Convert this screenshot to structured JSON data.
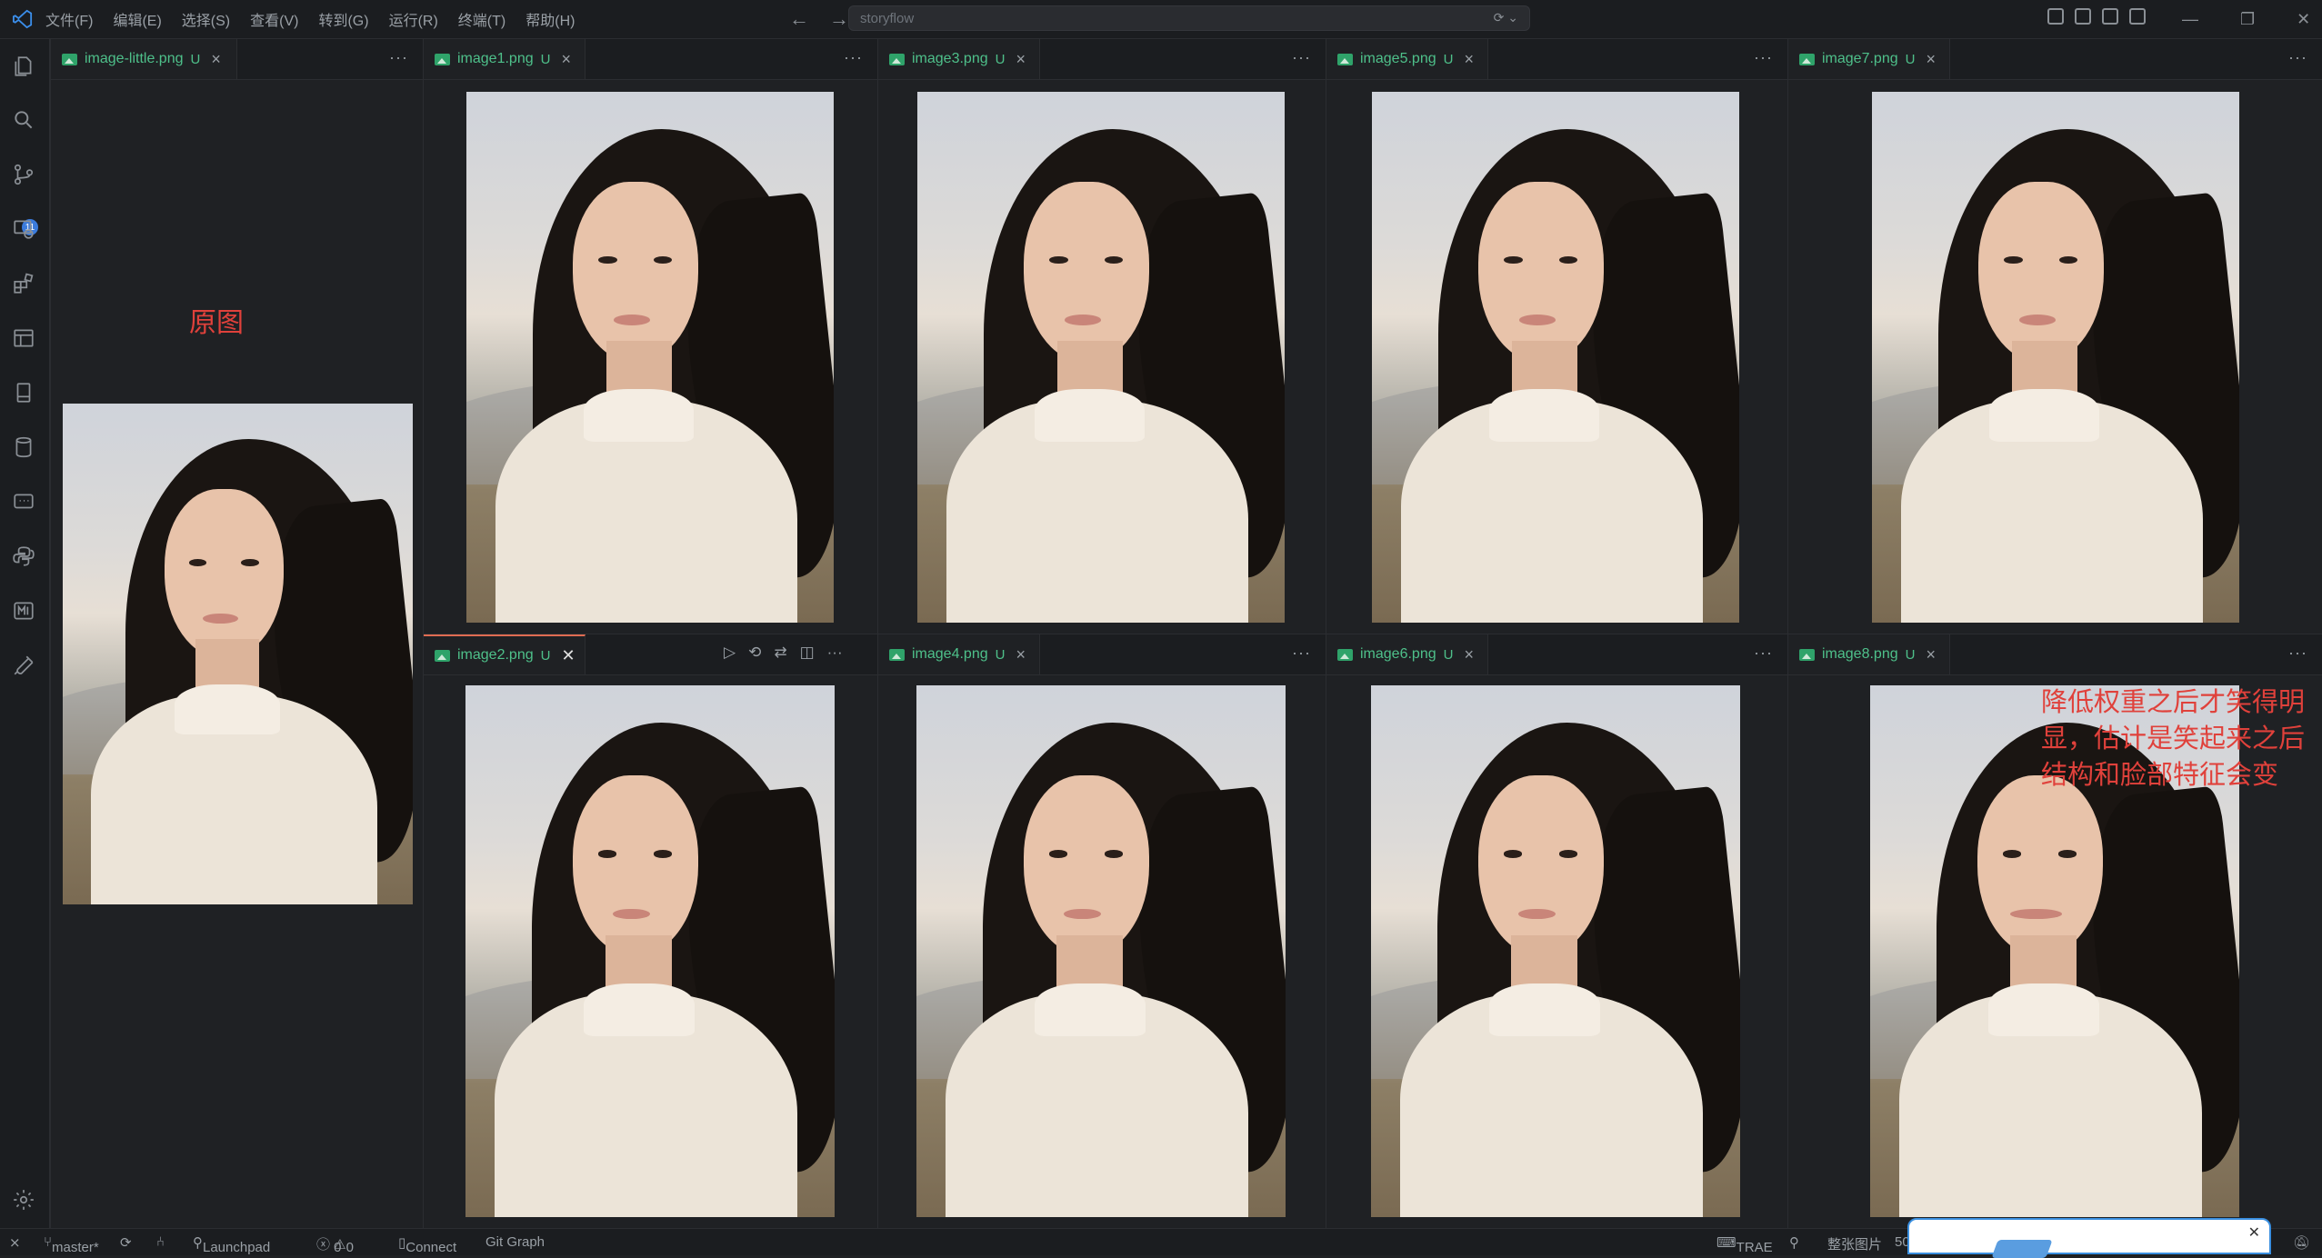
{
  "menu": [
    "文件(F)",
    "编辑(E)",
    "选择(S)",
    "查看(V)",
    "转到(G)",
    "运行(R)",
    "终端(T)",
    "帮助(H)"
  ],
  "search": {
    "placeholder": "storyflow"
  },
  "activity": {
    "scm_badge": "11"
  },
  "groups": {
    "original": {
      "tab": "image-little.png",
      "status": "U",
      "annotation": "原图"
    },
    "g1": {
      "tab": "image1.png",
      "status": "U"
    },
    "g3": {
      "tab": "image3.png",
      "status": "U"
    },
    "g5": {
      "tab": "image5.png",
      "status": "U"
    },
    "g7": {
      "tab": "image7.png",
      "status": "U"
    },
    "g2": {
      "tab": "image2.png",
      "status": "U"
    },
    "g4": {
      "tab": "image4.png",
      "status": "U"
    },
    "g6": {
      "tab": "image6.png",
      "status": "U"
    },
    "g8": {
      "tab": "image8.png",
      "status": "U"
    }
  },
  "annotation_note": [
    "降低权重之后才笑得明",
    "显，估计是笑起来之后",
    "结构和脸部特征会变"
  ],
  "status": {
    "branch": "master*",
    "launchpad": "Launchpad",
    "errors": "0",
    "warnings": "0",
    "connect": "Connect",
    "git_graph": "Git Graph",
    "trae": "TRAE",
    "right_text": "整张图片",
    "right_num": "50"
  },
  "colors": {
    "accent_red": "#e0413b",
    "modified_green": "#4ec08a",
    "active_tab_border": "#e06c52"
  }
}
